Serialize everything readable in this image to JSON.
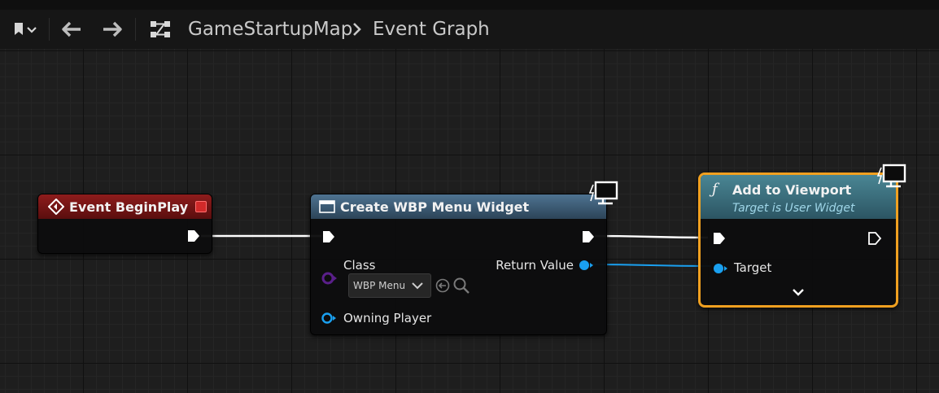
{
  "toolbar": {
    "bookmark_icon": "bookmark-icon",
    "back_icon": "arrow-left-icon",
    "forward_icon": "arrow-right-icon",
    "graph_icon": "blueprint-graph-icon",
    "breadcrumb": [
      "GameStartupMap",
      "Event Graph"
    ],
    "separator": ">"
  },
  "nodes": {
    "begin_play": {
      "title": "Event BeginPlay",
      "header_color": "#7a1414",
      "icon": "event-diamond-icon"
    },
    "create_widget": {
      "title": "Create WBP Menu Widget",
      "header_color": "#3d5a72",
      "icon": "widget-window-icon",
      "class_label": "Class",
      "class_value": "WBP Menu",
      "return_label": "Return Value",
      "owning_player_label": "Owning Player",
      "client_icon": "monitor-icon"
    },
    "add_to_viewport": {
      "title": "Add to Viewport",
      "subtitle": "Target is User Widget",
      "header_color": "#3d6e7c",
      "icon": "function-f-icon",
      "target_label": "Target",
      "client_icon": "monitor-icon",
      "selected_color": "#f0a020"
    }
  },
  "colors": {
    "exec_wire": "#ffffff",
    "object_pin": "#1aa0f0",
    "class_pin": "#5a1f8a"
  }
}
